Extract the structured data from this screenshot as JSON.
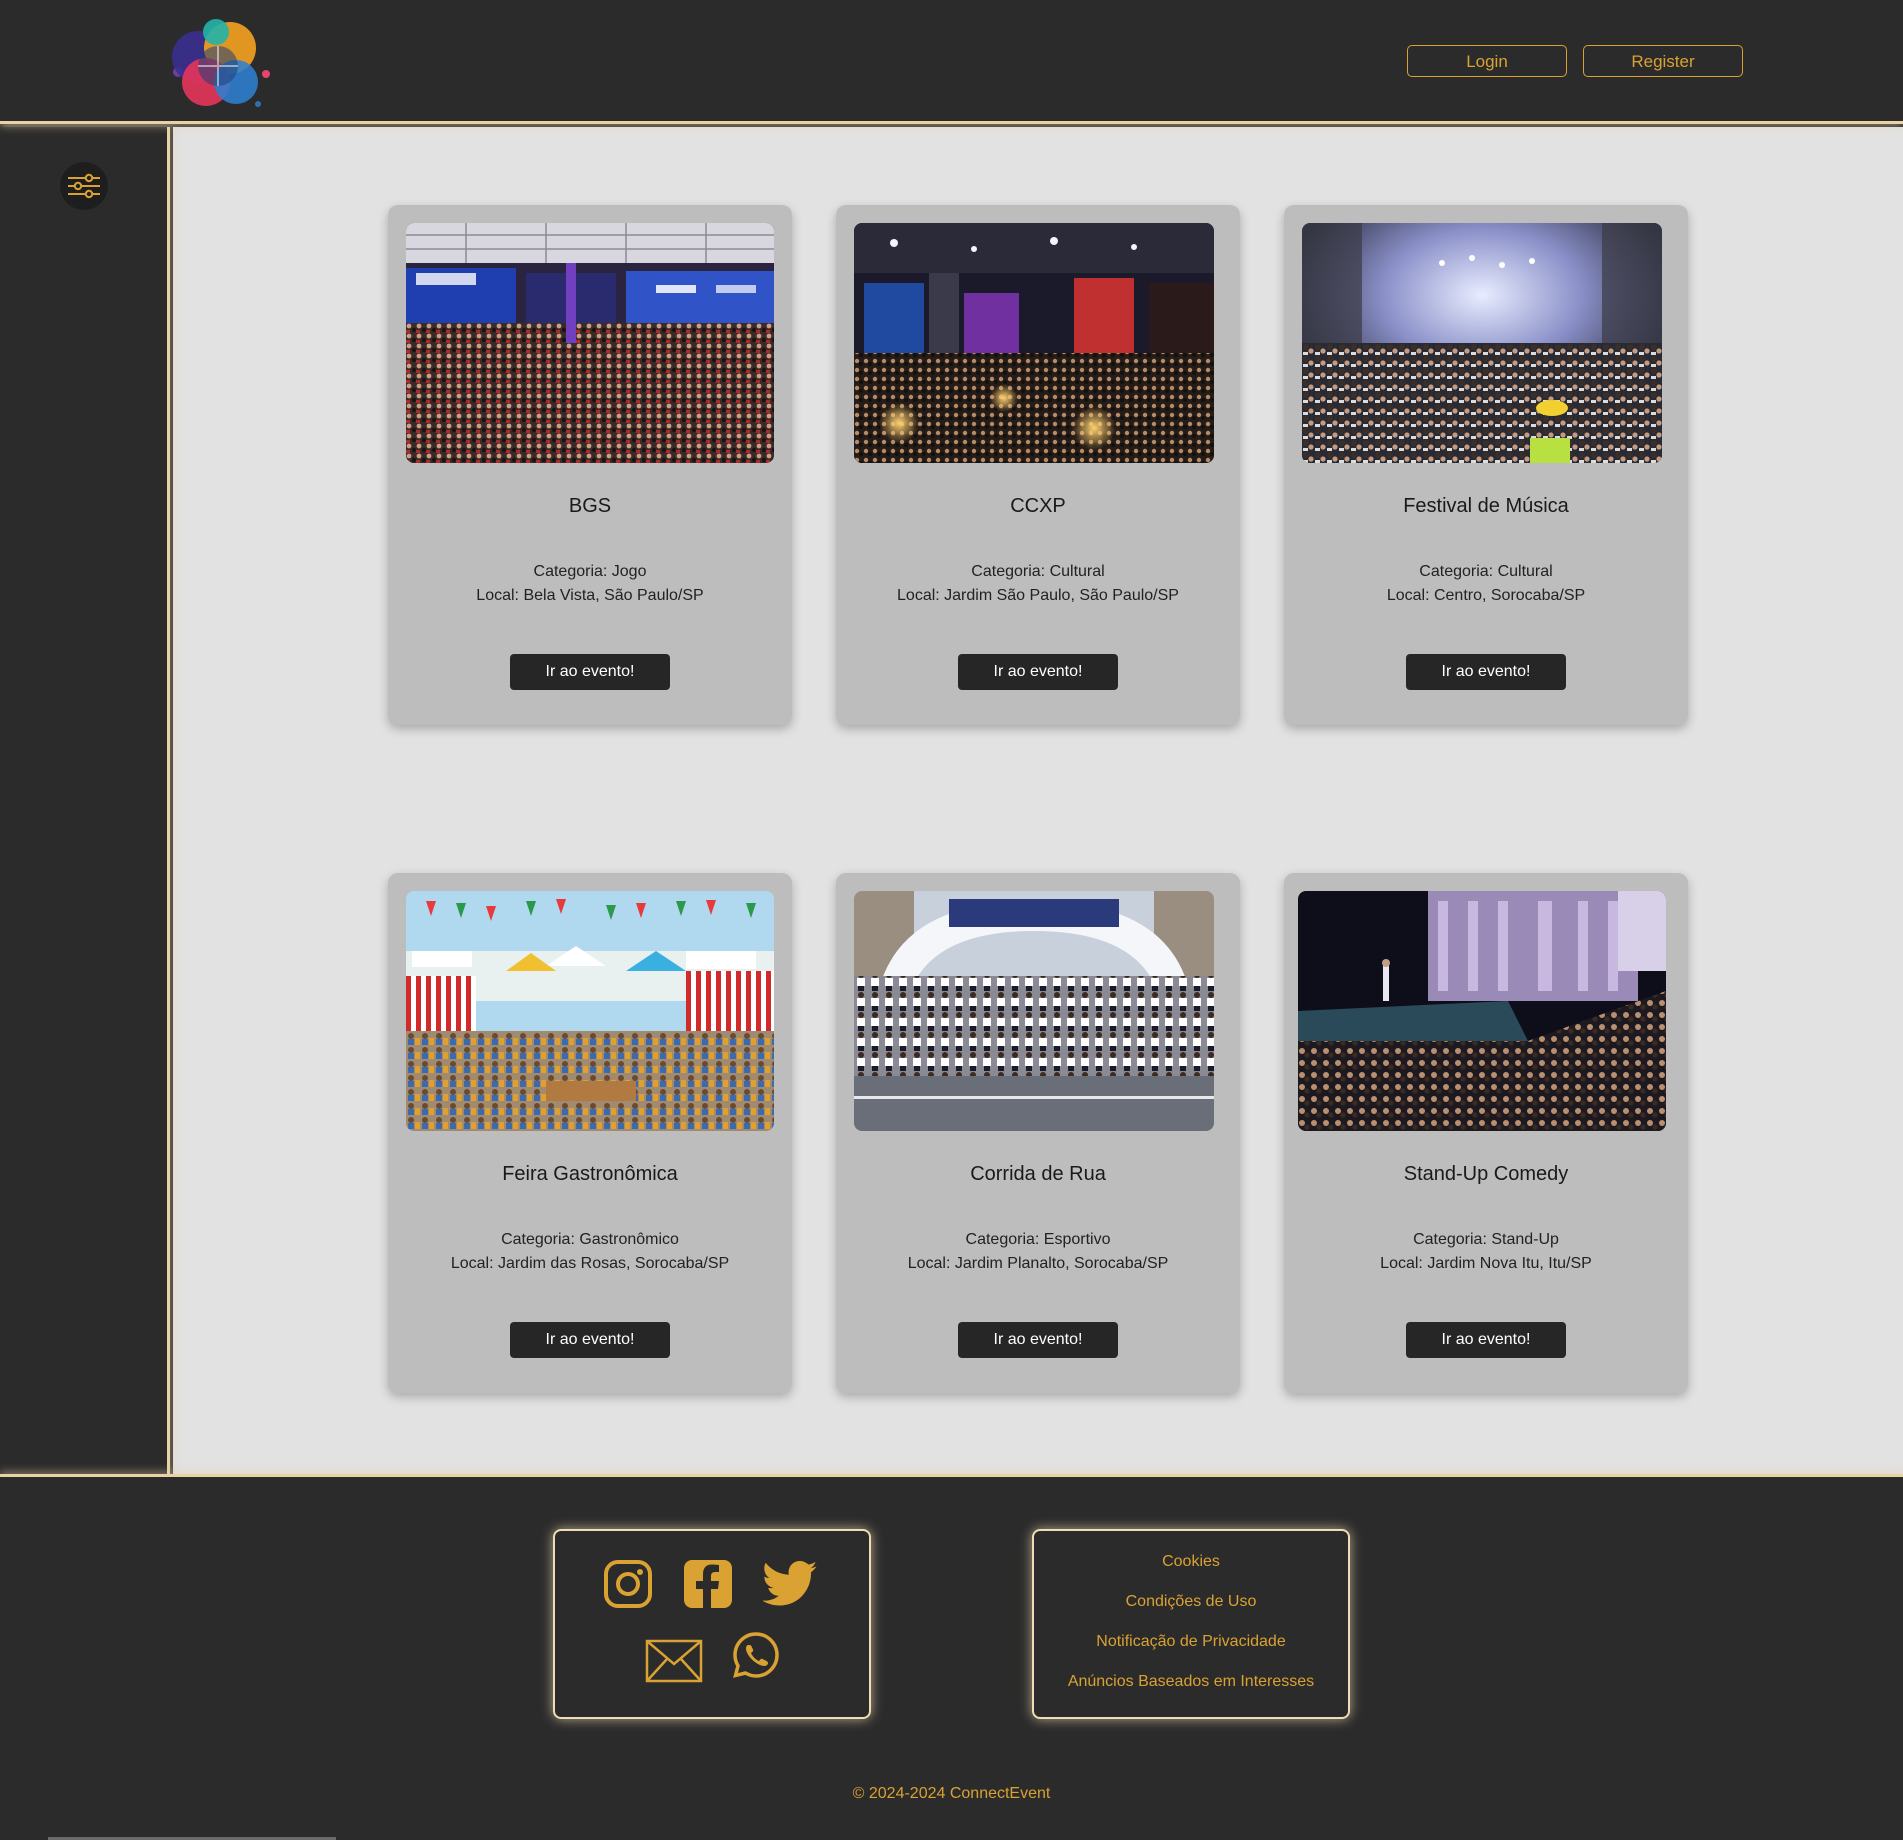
{
  "header": {
    "login_label": "Login",
    "register_label": "Register",
    "accent_color": "#d9a232"
  },
  "sidebar": {
    "filter_icon": "sliders-icon"
  },
  "events": [
    {
      "title": "BGS",
      "category": "Categoria: Jogo",
      "location": "Local: Bela Vista, São Paulo/SP",
      "button": "Ir ao evento!"
    },
    {
      "title": "CCXP",
      "category": "Categoria: Cultural",
      "location": "Local: Jardim São Paulo, São Paulo/SP",
      "button": "Ir ao evento!"
    },
    {
      "title": "Festival de Música",
      "category": "Categoria: Cultural",
      "location": "Local: Centro, Sorocaba/SP",
      "button": "Ir ao evento!"
    },
    {
      "title": "Feira Gastronômica",
      "category": "Categoria: Gastronômico",
      "location": "Local: Jardim das Rosas, Sorocaba/SP",
      "button": "Ir ao evento!"
    },
    {
      "title": "Corrida de Rua",
      "category": "Categoria: Esportivo",
      "location": "Local: Jardim Planalto, Sorocaba/SP",
      "button": "Ir ao evento!"
    },
    {
      "title": "Stand-Up Comedy",
      "category": "Categoria: Stand-Up",
      "location": "Local: Jardim Nova Itu, Itu/SP",
      "button": "Ir ao evento!"
    }
  ],
  "footer": {
    "social_icons": [
      "instagram-icon",
      "facebook-icon",
      "twitter-icon",
      "email-icon",
      "whatsapp-icon"
    ],
    "links": [
      "Cookies",
      "Condições de Uso",
      "Notificação de Privacidade",
      "Anúncios Baseados em Interesses"
    ],
    "copyright": "© 2024-2024 ConnectEvent"
  }
}
